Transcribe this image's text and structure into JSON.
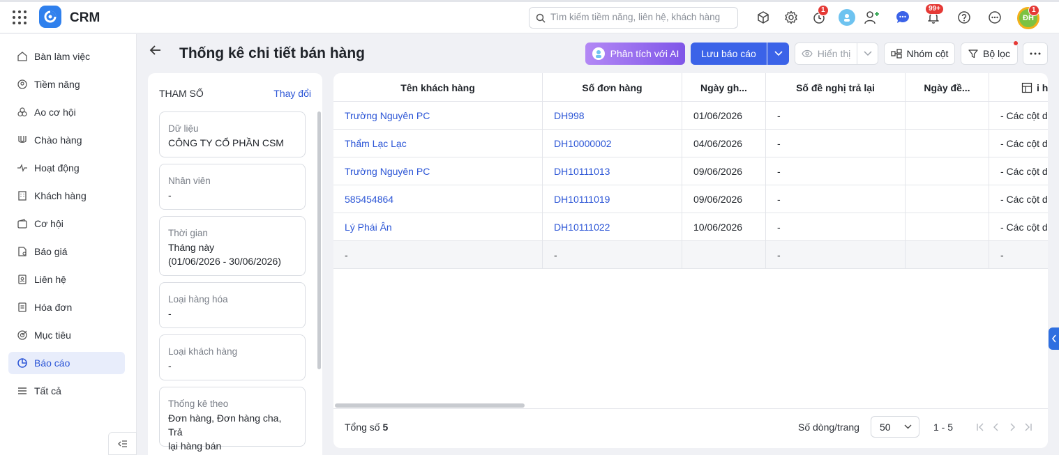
{
  "app": {
    "name": "CRM"
  },
  "search": {
    "placeholder": "Tìm kiếm tiềm năng, liên hệ, khách hàng"
  },
  "topbar": {
    "timer_badge": "1",
    "notification_badge": "99+",
    "user_initials": "ĐH",
    "user_badge": "1"
  },
  "sidebar": {
    "items": [
      {
        "label": "Bàn làm việc",
        "icon": "home-icon"
      },
      {
        "label": "Tiềm năng",
        "icon": "target-user-icon"
      },
      {
        "label": "Ao cơ hội",
        "icon": "circles-icon"
      },
      {
        "label": "Chào hàng",
        "icon": "magnet-icon"
      },
      {
        "label": "Hoạt động",
        "icon": "activity-icon"
      },
      {
        "label": "Khách hàng",
        "icon": "building-icon"
      },
      {
        "label": "Cơ hội",
        "icon": "wallet-icon"
      },
      {
        "label": "Báo giá",
        "icon": "quote-doc-icon"
      },
      {
        "label": "Liên hệ",
        "icon": "contact-book-icon"
      },
      {
        "label": "Hóa đơn",
        "icon": "invoice-icon"
      },
      {
        "label": "Mục tiêu",
        "icon": "goal-icon"
      },
      {
        "label": "Báo cáo",
        "icon": "pie-chart-icon",
        "active": true
      },
      {
        "label": "Tất cả",
        "icon": "menu-icon"
      }
    ]
  },
  "header": {
    "title": "Thống kê chi tiết bán hàng",
    "ai_button": "Phân tích với AI",
    "save_button": "Lưu báo cáo",
    "view_button": "Hiển thị",
    "group_button": "Nhóm cột",
    "filter_button": "Bộ lọc"
  },
  "params": {
    "heading": "THAM SỐ",
    "change_link": "Thay đổi",
    "cards": [
      {
        "label": "Dữ liệu",
        "value": "CÔNG TY CỔ PHẦN CSM"
      },
      {
        "label": "Nhân viên",
        "value": "-"
      },
      {
        "label": "Thời gian",
        "value": "Tháng này",
        "value2": "(01/06/2026 - 30/06/2026)"
      },
      {
        "label": "Loại hàng hóa",
        "value": "-"
      },
      {
        "label": "Loại khách hàng",
        "value": "-"
      },
      {
        "label": "Thống kê theo",
        "value": "Đơn hàng, Đơn hàng cha, Trả",
        "value2": "lại hàng bán"
      }
    ]
  },
  "table": {
    "columns": [
      "Tên khách hàng",
      "Số đơn hàng",
      "Ngày gh...",
      "Số đề nghị trả lại",
      "Ngày đề...",
      "i hà"
    ],
    "rows": [
      [
        "Trường Nguyên PC",
        "DH998",
        "01/06/2026",
        "-",
        "",
        "- Các cột d"
      ],
      [
        "Thẩm Lạc Lạc",
        "DH10000002",
        "04/06/2026",
        "-",
        "",
        "- Các cột d"
      ],
      [
        "Trường Nguyên PC",
        "DH10111013",
        "09/06/2026",
        "-",
        "",
        "- Các cột d"
      ],
      [
        "585454864",
        "DH10111019",
        "09/06/2026",
        "-",
        "",
        "- Các cột d"
      ],
      [
        "Lý Phái Ân",
        "DH10111022",
        "10/06/2026",
        "-",
        "",
        "- Các cột d"
      ]
    ],
    "total_row": [
      "-",
      "-",
      "",
      "-",
      "",
      "-"
    ]
  },
  "footer": {
    "total_label": "Tổng số",
    "total_value": "5",
    "rows_per_page_label": "Số dòng/trang",
    "rows_per_page": "50",
    "range": "1 - 5"
  },
  "colors": {
    "accent": "#3b63e8",
    "link": "#2b55d6",
    "badge": "#e53935"
  }
}
